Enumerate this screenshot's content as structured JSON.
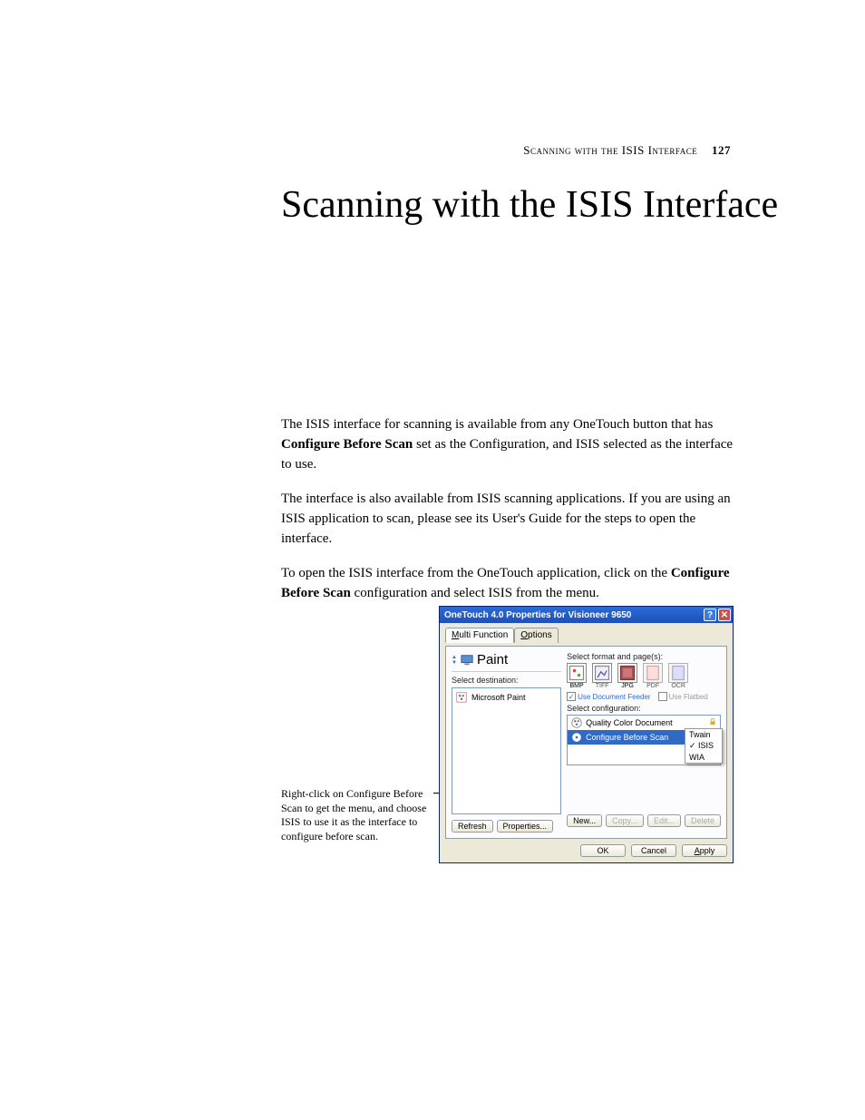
{
  "header": {
    "section": "Scanning with the ISIS Interface",
    "page": "127"
  },
  "title": "Scanning with the ISIS Interface",
  "paragraphs": {
    "p1a": "The ISIS interface for scanning is available from any OneTouch button that has ",
    "p1b": "Configure Before Scan",
    "p1c": " set as the Configuration, and ISIS selected as the interface to use.",
    "p2": "The interface is also available from ISIS scanning applications. If you are using an ISIS application to scan, please see its User's Guide for the steps to open the interface.",
    "p3a": "To open the ISIS interface from the OneTouch application, click on the ",
    "p3b": "Configure Before Scan",
    "p3c": " configuration and select ISIS from the menu."
  },
  "callout": "Right-click on Configure Before Scan to get the menu, and choose ISIS to use it as the interface to configure before scan.",
  "dialog": {
    "title": "OneTouch 4.0 Properties for Visioneer 9650",
    "tabs": {
      "t1": "Multi Function",
      "t2": "Options"
    },
    "paint": "Paint",
    "select_dest": "Select destination:",
    "dest_item": "Microsoft Paint",
    "select_format": "Select format and page(s):",
    "formats": {
      "bmp": "BMP",
      "tiff": "TIFF",
      "jpg": "JPG",
      "pdf": "PDF",
      "ocr": "OCR"
    },
    "use_feeder": "Use Document Feeder",
    "use_flatbed": "Use Flatbed",
    "select_config": "Select configuration:",
    "config1": "Quality Color Document",
    "config2": "Configure Before Scan",
    "menu": {
      "twain": "Twain",
      "isis": "ISIS",
      "wia": "WIA"
    },
    "buttons": {
      "refresh": "Refresh",
      "properties": "Properties...",
      "new": "New...",
      "copy": "Copy...",
      "edit": "Edit...",
      "delete": "Delete",
      "ok": "OK",
      "cancel": "Cancel",
      "apply": "Apply"
    }
  }
}
